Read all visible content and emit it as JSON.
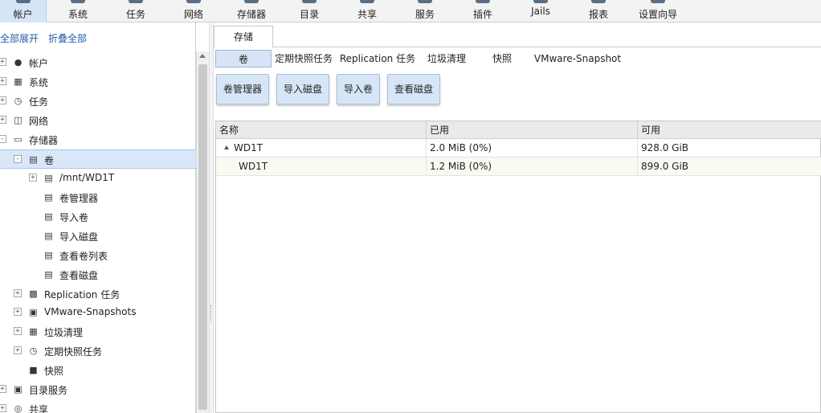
{
  "nav": {
    "items": [
      {
        "label": "帐户",
        "icon": "users-icon"
      },
      {
        "label": "系统",
        "icon": "system-icon"
      },
      {
        "label": "任务",
        "icon": "tasks-icon"
      },
      {
        "label": "网络",
        "icon": "network-icon"
      },
      {
        "label": "存储器",
        "icon": "storage-icon"
      },
      {
        "label": "目录",
        "icon": "directory-icon"
      },
      {
        "label": "共享",
        "icon": "sharing-icon"
      },
      {
        "label": "服务",
        "icon": "services-icon"
      },
      {
        "label": "插件",
        "icon": "plugins-icon"
      },
      {
        "label": "Jails",
        "icon": "jails-icon"
      },
      {
        "label": "报表",
        "icon": "reporting-icon"
      },
      {
        "label": "设置向导",
        "icon": "wizard-icon"
      }
    ],
    "active_index": 0
  },
  "tree": {
    "expand_all": "全部展开",
    "collapse_all": "折叠全部",
    "items": [
      {
        "label": "帐户",
        "icon": "users-icon",
        "toggle": "+"
      },
      {
        "label": "系统",
        "icon": "system-icon",
        "toggle": "+"
      },
      {
        "label": "任务",
        "icon": "tasks-icon",
        "toggle": "+"
      },
      {
        "label": "网络",
        "icon": "network-icon",
        "toggle": "+"
      },
      {
        "label": "存储器",
        "icon": "storage-folder-icon",
        "toggle": "-"
      },
      {
        "label": "卷",
        "icon": "volume-icon",
        "toggle": "-"
      },
      {
        "label": "/mnt/WD1T",
        "icon": "volume-icon",
        "toggle": "+"
      },
      {
        "label": "卷管理器",
        "icon": "volume-manager-icon",
        "toggle": ""
      },
      {
        "label": "导入卷",
        "icon": "import-volume-icon",
        "toggle": ""
      },
      {
        "label": "导入磁盘",
        "icon": "import-disk-icon",
        "toggle": ""
      },
      {
        "label": "查看卷列表",
        "icon": "view-volumes-icon",
        "toggle": ""
      },
      {
        "label": "查看磁盘",
        "icon": "view-disks-icon",
        "toggle": ""
      },
      {
        "label": "Replication 任务",
        "icon": "replication-icon",
        "toggle": "+"
      },
      {
        "label": "VMware-Snapshots",
        "icon": "vmware-icon",
        "toggle": "+"
      },
      {
        "label": "垃圾清理",
        "icon": "scrub-icon",
        "toggle": "+"
      },
      {
        "label": "定期快照任务",
        "icon": "periodic-snapshot-icon",
        "toggle": "+"
      },
      {
        "label": "快照",
        "icon": "snapshot-icon",
        "toggle": ""
      },
      {
        "label": "目录服务",
        "icon": "directory-service-icon",
        "toggle": "+"
      },
      {
        "label": "共享",
        "icon": "sharing-icon",
        "toggle": "+"
      }
    ],
    "selected_index": 5
  },
  "main": {
    "tab_label": "存储",
    "subtabs": [
      "卷",
      "定期快照任务",
      "Replication 任务",
      "垃圾清理",
      "快照",
      "VMware-Snapshot"
    ],
    "active_subtab": 0,
    "buttons": [
      "卷管理器",
      "导入磁盘",
      "导入卷",
      "查看磁盘"
    ],
    "table": {
      "columns": [
        "名称",
        "已用",
        "可用"
      ],
      "rows": [
        {
          "name": "WD1T",
          "used": "2.0 MiB (0%)",
          "avail": "928.0 GiB",
          "expanded": true
        },
        {
          "name": "WD1T",
          "used": "1.2 MiB (0%)",
          "avail": "899.0 GiB",
          "expanded": false
        }
      ]
    }
  }
}
